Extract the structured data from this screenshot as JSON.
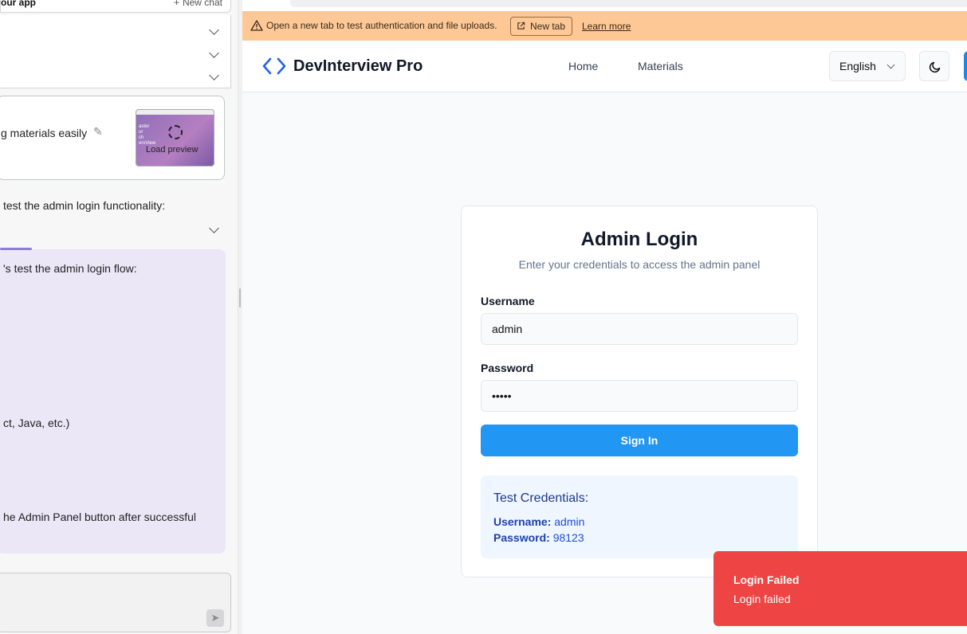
{
  "chat_panel": {
    "title": "our app",
    "new_chat": "New chat",
    "preview_card_text": "g materials easily",
    "thumbnail_text": "aster\nur\nch\nervView",
    "load_preview": "Load preview",
    "message_1": "test the admin login functionality:",
    "message_2": "'s test the admin login flow:",
    "message_3": "ct, Java, etc.)",
    "message_4": "he Admin Panel button after successful"
  },
  "preview": {
    "url": "/login",
    "banner_text": "Open a new tab to test authentication and file uploads.",
    "new_tab_label": "New tab",
    "learn_more": "Learn more",
    "brand": "DevInterview Pro",
    "nav": {
      "home": "Home",
      "materials": "Materials"
    },
    "language": "English",
    "login": {
      "title": "Admin Login",
      "subtitle": "Enter your credentials to access the admin panel",
      "username_label": "Username",
      "username_value": "admin",
      "password_label": "Password",
      "password_value": "•••••",
      "sign_in": "Sign In"
    },
    "credentials": {
      "title": "Test Credentials:",
      "username_key": "Username:",
      "username_val": "admin",
      "password_key": "Password:",
      "password_val": "98123"
    },
    "toast": {
      "title": "Login Failed",
      "message": "Login failed"
    }
  },
  "colors": {
    "banner": "#fdc896",
    "primary": "#2196f3",
    "toast": "#ef4444",
    "chat_bubble": "#ebe7f7"
  },
  "icons": [
    "warning-icon",
    "external-link-icon",
    "code-brackets-icon",
    "moon-icon",
    "pencil-icon",
    "send-icon",
    "chevron-down-icon",
    "plus-icon",
    "spinner-icon"
  ]
}
